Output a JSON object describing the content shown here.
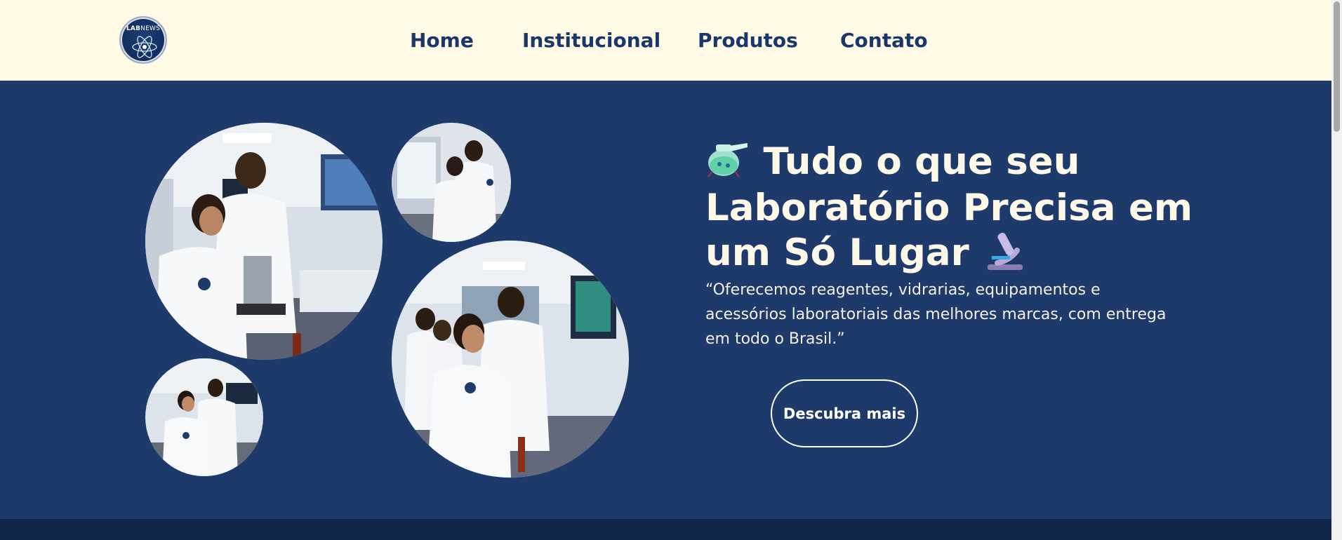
{
  "header": {
    "logo": {
      "text_bold": "LAB",
      "text_thin": "NEWS",
      "icon": "atom-logo-icon"
    },
    "nav": [
      {
        "label": "Home"
      },
      {
        "label": "Institucional"
      },
      {
        "label": "Produtos"
      },
      {
        "label": "Contato"
      }
    ]
  },
  "hero": {
    "headline": "Tudo o que seu Laboratório Precisa em um Só Lugar",
    "headline_icons": [
      "flask-emoji-icon",
      "microscope-emoji-icon"
    ],
    "lead": "“Oferecemos reagentes, vidrarias, equipamentos e acessórios laboratoriais das melhores marcas, com entrega em todo o Brasil.”",
    "cta_label": "Descubra mais",
    "photos": [
      "lab-team-microscope-photo",
      "lab-fume-hood-photo",
      "lab-team-celebrating-photo",
      "lab-team-testing-photo"
    ]
  },
  "colors": {
    "header_bg": "#fefae6",
    "nav_text": "#1b3769",
    "hero_bg": "#1e3a6b",
    "bottom_band": "#0f2549",
    "hero_text": "#fdf8e8"
  }
}
